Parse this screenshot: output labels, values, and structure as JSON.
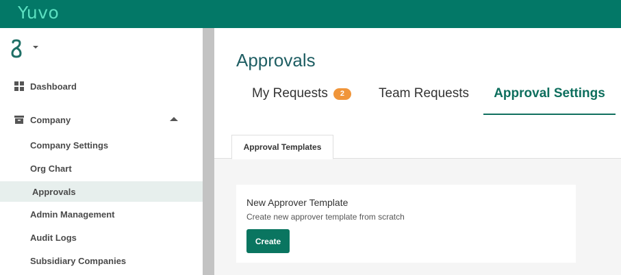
{
  "app": {
    "brand": "Yuvo"
  },
  "colors": {
    "topbar": "#037867",
    "brand_text": "#5ce0c1",
    "accent": "#0d6e5d",
    "badge": "#f0953a",
    "button": "#0a7560",
    "active_nav_bg": "#e7efed"
  },
  "sidebar": {
    "org_switch_icon": "org-logo-icon",
    "items": [
      {
        "label": "Dashboard",
        "icon": "dashboard-grid-icon"
      },
      {
        "label": "Company",
        "icon": "archive-box-icon",
        "expanded": true,
        "children": [
          {
            "label": "Company Settings"
          },
          {
            "label": "Org Chart"
          },
          {
            "label": "Approvals",
            "active": true
          },
          {
            "label": "Admin Management"
          },
          {
            "label": "Audit Logs"
          },
          {
            "label": "Subsidiary Companies"
          }
        ]
      }
    ]
  },
  "main": {
    "title": "Approvals",
    "tabs": [
      {
        "label": "My Requests",
        "badge": "2"
      },
      {
        "label": "Team Requests"
      },
      {
        "label": "Approval Settings",
        "active": true
      }
    ],
    "subtabs": [
      {
        "label": "Approval Templates",
        "active": true
      }
    ],
    "card": {
      "title": "New Approver Template",
      "description": "Create new approver template from scratch",
      "button": "Create"
    }
  }
}
